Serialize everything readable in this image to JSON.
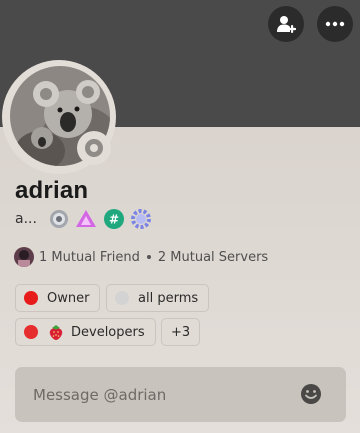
{
  "header": {
    "add_friend_icon": "add-friend-icon",
    "more_icon": "ellipsis-icon"
  },
  "profile": {
    "username": "adrian",
    "pronouns": "a...",
    "status": "offline",
    "badges": [
      "hypesquad-badge",
      "triangle-badge",
      "channel-badge",
      "cog-badge"
    ]
  },
  "mutual": {
    "friends": "1 Mutual Friend",
    "servers": "2 Mutual Servers"
  },
  "roles": [
    {
      "name": "Owner",
      "color": "#e81b1b"
    },
    {
      "name": "all perms",
      "color": "#d3d3d3"
    },
    {
      "name": "Developers",
      "color": "#e62e2e",
      "icon": "strawberry-icon"
    }
  ],
  "roles_more": "+3",
  "message": {
    "placeholder": "Message @adrian"
  },
  "colors": {
    "banner": "#4a4a4a",
    "card": "#ddd7d1"
  }
}
